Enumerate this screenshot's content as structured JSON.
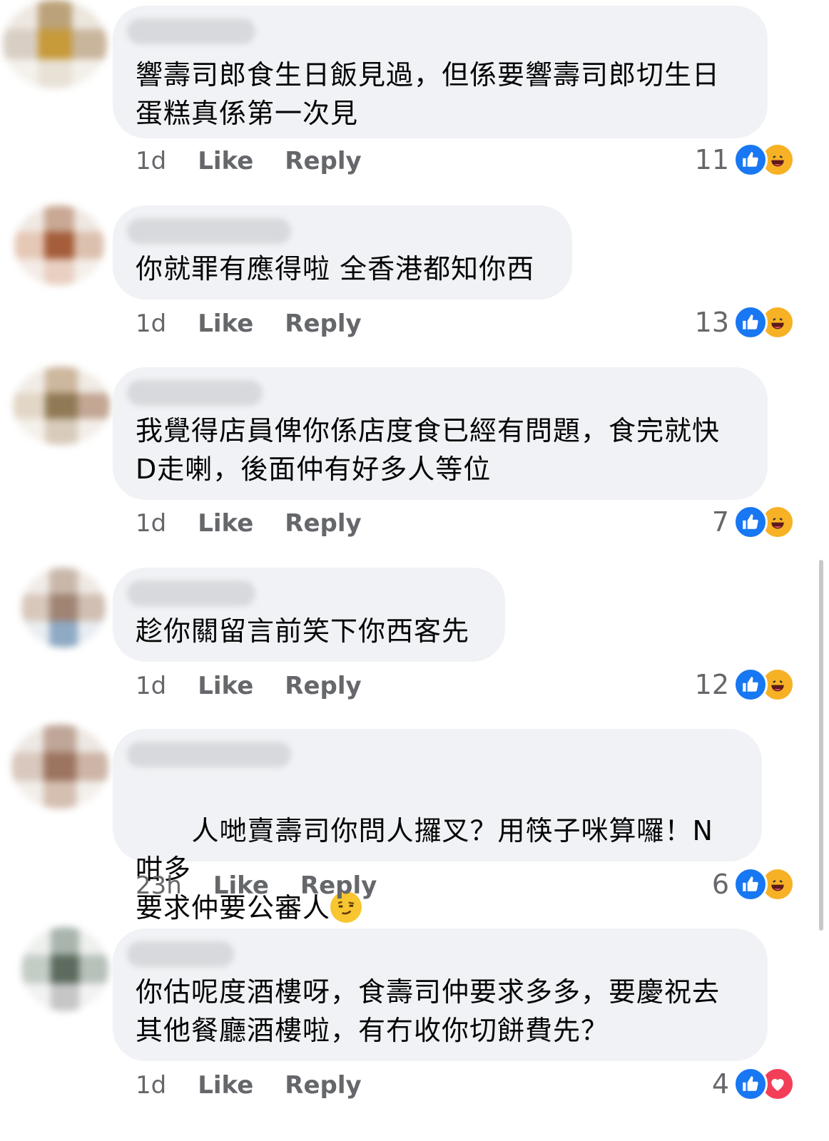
{
  "comments": [
    {
      "text": "響壽司郎食生日飯見過，但係要響壽司郎切生日\n蛋糕真係第一次見",
      "time": "1d",
      "like": "Like",
      "reply": "Reply",
      "count": "11",
      "reactions": [
        "like",
        "haha"
      ]
    },
    {
      "text": "你就罪有應得啦 全香港都知你西",
      "time": "1d",
      "like": "Like",
      "reply": "Reply",
      "count": "13",
      "reactions": [
        "like",
        "haha"
      ]
    },
    {
      "text": "我覺得店員俾你係店度食已經有問題，食完就快\nD走喇，後面仲有好多人等位",
      "time": "1d",
      "like": "Like",
      "reply": "Reply",
      "count": "7",
      "reactions": [
        "like",
        "haha"
      ]
    },
    {
      "text": "趁你關留言前笑下你西客先",
      "time": "1d",
      "like": "Like",
      "reply": "Reply",
      "count": "12",
      "reactions": [
        "like",
        "haha"
      ]
    },
    {
      "text": "人哋賣壽司你問人攞叉？用筷子咪算囉！N咁多\n要求仲要公審人",
      "time": "23h",
      "like": "Like",
      "reply": "Reply",
      "count": "6",
      "reactions": [
        "like",
        "haha"
      ],
      "trailing_emoji": "smirk-emoji"
    },
    {
      "text": "你估呢度酒樓呀，食壽司仲要求多多，要慶祝去\n其他餐廳酒樓啦，有冇收你切餅費先？",
      "time": "1d",
      "like": "Like",
      "reply": "Reply",
      "count": "4",
      "reactions": [
        "like",
        "love"
      ]
    }
  ],
  "colors": {
    "bubble": "#f0f2f5",
    "like_blue": "#1877f2",
    "haha_yellow": "#f7b125",
    "love_red": "#f33e58",
    "meta_gray": "#65676b"
  }
}
